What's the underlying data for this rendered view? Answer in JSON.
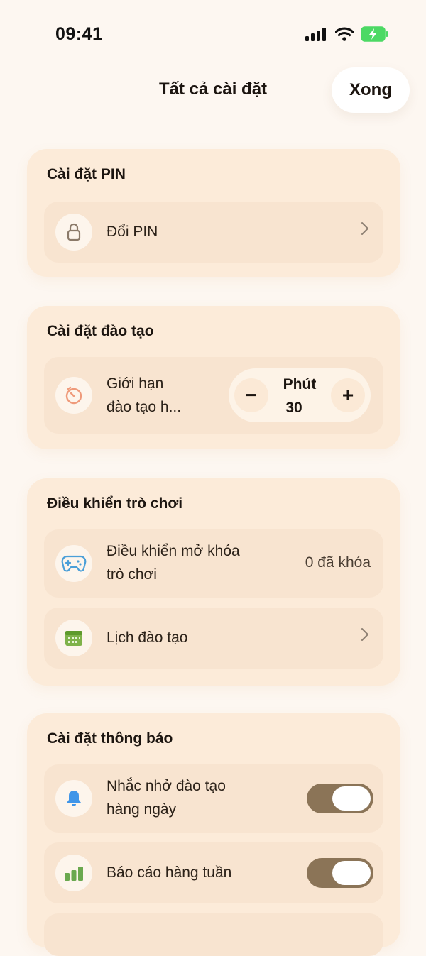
{
  "status_bar": {
    "time": "09:41"
  },
  "header": {
    "title": "Tất cả cài đặt",
    "done_label": "Xong"
  },
  "pin_settings": {
    "title": "Cài đặt PIN",
    "change_pin_label": "Đổi PIN"
  },
  "training_settings": {
    "title": "Cài đặt đào tạo",
    "limit_label_line1": "Giới hạn",
    "limit_label_line2": "đào tạo h...",
    "stepper": {
      "unit": "Phút",
      "value": "30",
      "minus": "−",
      "plus": "+"
    }
  },
  "game_control": {
    "title": "Điều khiển trò chơi",
    "unlock_label_line1": "Điều khiển mở khóa",
    "unlock_label_line2": "trò chơi",
    "locked_count": "0 đã khóa",
    "schedule_label": "Lịch đào tạo"
  },
  "notification_settings": {
    "title": "Cài đặt thông báo",
    "daily_reminder_line1": "Nhắc nhở đào tạo",
    "daily_reminder_line2": "hàng ngày",
    "daily_reminder_on": true,
    "weekly_report_label": "Báo cáo hàng tuần",
    "weekly_report_on": true
  },
  "colors": {
    "background": "#fdf7f1",
    "card": "#fcebd9",
    "row": "#f8e4d0",
    "toggle": "#8b7457",
    "battery": "#4cd964"
  }
}
